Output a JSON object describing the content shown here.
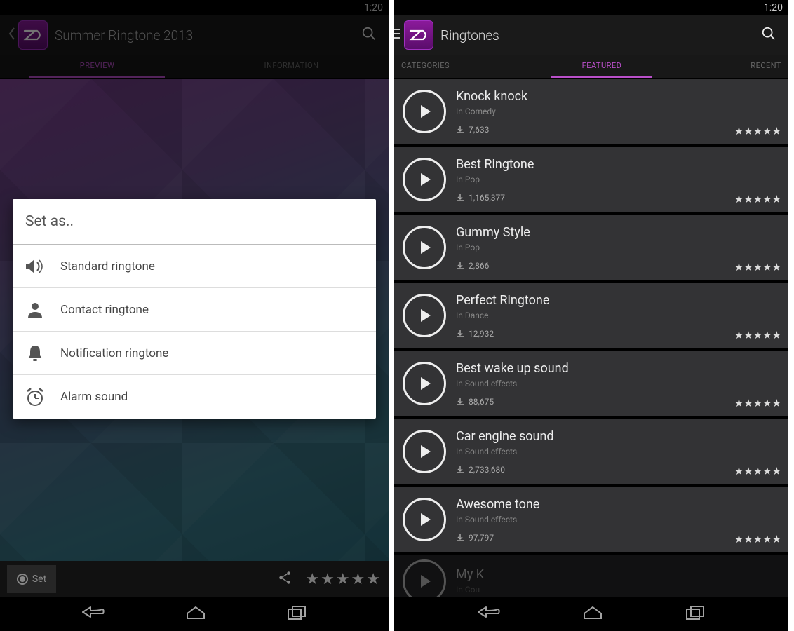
{
  "status_time": "1:20",
  "left": {
    "title": "Summer Ringtone 2013",
    "tabs": {
      "preview": "PREVIEW",
      "information": "INFORMATION"
    },
    "dialog_title": "Set as..",
    "options": [
      {
        "icon": "speaker-icon",
        "label": "Standard ringtone"
      },
      {
        "icon": "person-icon",
        "label": "Contact ringtone"
      },
      {
        "icon": "bell-icon",
        "label": "Notification ringtone"
      },
      {
        "icon": "alarm-icon",
        "label": "Alarm sound"
      }
    ],
    "set_label": "Set",
    "stars": "★★★★★"
  },
  "right": {
    "title": "Ringtones",
    "tabs": {
      "categories": "CATEGORIES",
      "featured": "FEATURED",
      "recent": "RECENT"
    },
    "items": [
      {
        "title": "Knock knock",
        "category": "In Comedy",
        "downloads": "7,633",
        "stars": "★★★★★"
      },
      {
        "title": "Best Ringtone",
        "category": "In Pop",
        "downloads": "1,165,377",
        "stars": "★★★★★"
      },
      {
        "title": "Gummy Style",
        "category": "In Pop",
        "downloads": "2,866",
        "stars": "★★★★★"
      },
      {
        "title": "Perfect Ringtone",
        "category": "In Dance",
        "downloads": "12,932",
        "stars": "★★★★★"
      },
      {
        "title": "Best wake up sound",
        "category": "In Sound effects",
        "downloads": "88,675",
        "stars": "★★★★★"
      },
      {
        "title": "Car engine sound",
        "category": "In Sound effects",
        "downloads": "2,733,680",
        "stars": "★★★★★"
      },
      {
        "title": "Awesome tone",
        "category": "In Sound effects",
        "downloads": "97,797",
        "stars": "★★★★★"
      }
    ],
    "partial": {
      "title": "My K",
      "category": "In Cou"
    }
  }
}
